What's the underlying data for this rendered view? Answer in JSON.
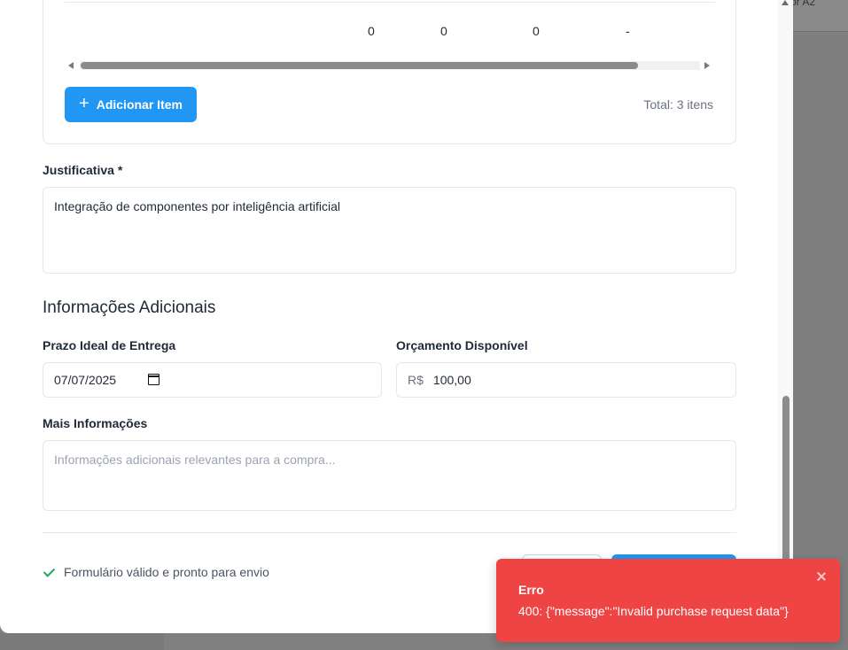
{
  "backdrop": {
    "header_text": "or A2"
  },
  "items_table": {
    "summary_row": [
      "0",
      "0",
      "0",
      "-"
    ],
    "add_button_label": "Adicionar Item",
    "total_text": "Total: 3 itens"
  },
  "justification": {
    "label": "Justificativa *",
    "value": "Integração de componentes por inteligência artificial"
  },
  "additional_info": {
    "section_title": "Informações Adicionais",
    "delivery_deadline": {
      "label": "Prazo Ideal de Entrega",
      "value": "07/07/2025",
      "icon": "calendar-icon"
    },
    "budget": {
      "label": "Orçamento Disponível",
      "currency": "R$",
      "value": "100,00"
    },
    "more_info": {
      "label": "Mais Informações",
      "placeholder": "Informações adicionais relevantes para a compra..."
    }
  },
  "footer": {
    "status_text": "Formulário válido e pronto para envio",
    "status_icon": "check-icon",
    "accent_color": "#2196f3"
  },
  "toast": {
    "title": "Erro",
    "message": "400: {\"message\":\"Invalid purchase request data\"}",
    "color": "#ef4444",
    "close_icon": "close-icon"
  }
}
